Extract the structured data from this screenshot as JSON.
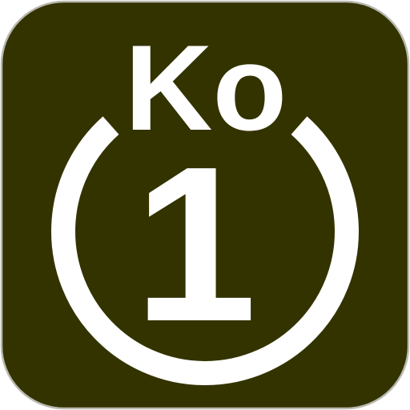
{
  "icon": {
    "line_code": "Ko",
    "station_number": "1",
    "colors": {
      "background": "#333300",
      "border": "#b9b9b0",
      "foreground": "#ffffff"
    },
    "ring_icon": "open-ring-icon"
  }
}
